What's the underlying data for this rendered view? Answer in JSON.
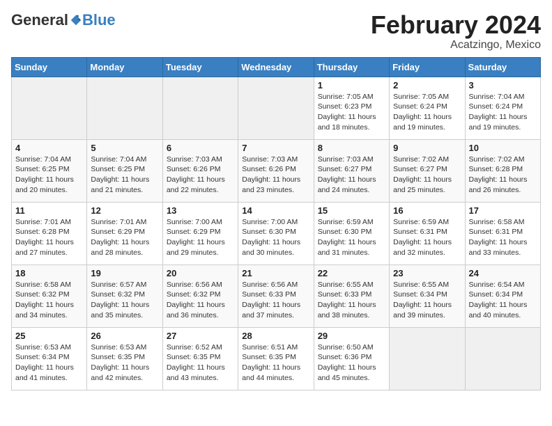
{
  "header": {
    "logo_general": "General",
    "logo_blue": "Blue",
    "month_title": "February 2024",
    "location": "Acatzingo, Mexico"
  },
  "weekdays": [
    "Sunday",
    "Monday",
    "Tuesday",
    "Wednesday",
    "Thursday",
    "Friday",
    "Saturday"
  ],
  "weeks": [
    [
      {
        "day": "",
        "info": ""
      },
      {
        "day": "",
        "info": ""
      },
      {
        "day": "",
        "info": ""
      },
      {
        "day": "",
        "info": ""
      },
      {
        "day": "1",
        "info": "Sunrise: 7:05 AM\nSunset: 6:23 PM\nDaylight: 11 hours\nand 18 minutes."
      },
      {
        "day": "2",
        "info": "Sunrise: 7:05 AM\nSunset: 6:24 PM\nDaylight: 11 hours\nand 19 minutes."
      },
      {
        "day": "3",
        "info": "Sunrise: 7:04 AM\nSunset: 6:24 PM\nDaylight: 11 hours\nand 19 minutes."
      }
    ],
    [
      {
        "day": "4",
        "info": "Sunrise: 7:04 AM\nSunset: 6:25 PM\nDaylight: 11 hours\nand 20 minutes."
      },
      {
        "day": "5",
        "info": "Sunrise: 7:04 AM\nSunset: 6:25 PM\nDaylight: 11 hours\nand 21 minutes."
      },
      {
        "day": "6",
        "info": "Sunrise: 7:03 AM\nSunset: 6:26 PM\nDaylight: 11 hours\nand 22 minutes."
      },
      {
        "day": "7",
        "info": "Sunrise: 7:03 AM\nSunset: 6:26 PM\nDaylight: 11 hours\nand 23 minutes."
      },
      {
        "day": "8",
        "info": "Sunrise: 7:03 AM\nSunset: 6:27 PM\nDaylight: 11 hours\nand 24 minutes."
      },
      {
        "day": "9",
        "info": "Sunrise: 7:02 AM\nSunset: 6:27 PM\nDaylight: 11 hours\nand 25 minutes."
      },
      {
        "day": "10",
        "info": "Sunrise: 7:02 AM\nSunset: 6:28 PM\nDaylight: 11 hours\nand 26 minutes."
      }
    ],
    [
      {
        "day": "11",
        "info": "Sunrise: 7:01 AM\nSunset: 6:28 PM\nDaylight: 11 hours\nand 27 minutes."
      },
      {
        "day": "12",
        "info": "Sunrise: 7:01 AM\nSunset: 6:29 PM\nDaylight: 11 hours\nand 28 minutes."
      },
      {
        "day": "13",
        "info": "Sunrise: 7:00 AM\nSunset: 6:29 PM\nDaylight: 11 hours\nand 29 minutes."
      },
      {
        "day": "14",
        "info": "Sunrise: 7:00 AM\nSunset: 6:30 PM\nDaylight: 11 hours\nand 30 minutes."
      },
      {
        "day": "15",
        "info": "Sunrise: 6:59 AM\nSunset: 6:30 PM\nDaylight: 11 hours\nand 31 minutes."
      },
      {
        "day": "16",
        "info": "Sunrise: 6:59 AM\nSunset: 6:31 PM\nDaylight: 11 hours\nand 32 minutes."
      },
      {
        "day": "17",
        "info": "Sunrise: 6:58 AM\nSunset: 6:31 PM\nDaylight: 11 hours\nand 33 minutes."
      }
    ],
    [
      {
        "day": "18",
        "info": "Sunrise: 6:58 AM\nSunset: 6:32 PM\nDaylight: 11 hours\nand 34 minutes."
      },
      {
        "day": "19",
        "info": "Sunrise: 6:57 AM\nSunset: 6:32 PM\nDaylight: 11 hours\nand 35 minutes."
      },
      {
        "day": "20",
        "info": "Sunrise: 6:56 AM\nSunset: 6:32 PM\nDaylight: 11 hours\nand 36 minutes."
      },
      {
        "day": "21",
        "info": "Sunrise: 6:56 AM\nSunset: 6:33 PM\nDaylight: 11 hours\nand 37 minutes."
      },
      {
        "day": "22",
        "info": "Sunrise: 6:55 AM\nSunset: 6:33 PM\nDaylight: 11 hours\nand 38 minutes."
      },
      {
        "day": "23",
        "info": "Sunrise: 6:55 AM\nSunset: 6:34 PM\nDaylight: 11 hours\nand 39 minutes."
      },
      {
        "day": "24",
        "info": "Sunrise: 6:54 AM\nSunset: 6:34 PM\nDaylight: 11 hours\nand 40 minutes."
      }
    ],
    [
      {
        "day": "25",
        "info": "Sunrise: 6:53 AM\nSunset: 6:34 PM\nDaylight: 11 hours\nand 41 minutes."
      },
      {
        "day": "26",
        "info": "Sunrise: 6:53 AM\nSunset: 6:35 PM\nDaylight: 11 hours\nand 42 minutes."
      },
      {
        "day": "27",
        "info": "Sunrise: 6:52 AM\nSunset: 6:35 PM\nDaylight: 11 hours\nand 43 minutes."
      },
      {
        "day": "28",
        "info": "Sunrise: 6:51 AM\nSunset: 6:35 PM\nDaylight: 11 hours\nand 44 minutes."
      },
      {
        "day": "29",
        "info": "Sunrise: 6:50 AM\nSunset: 6:36 PM\nDaylight: 11 hours\nand 45 minutes."
      },
      {
        "day": "",
        "info": ""
      },
      {
        "day": "",
        "info": ""
      }
    ]
  ]
}
